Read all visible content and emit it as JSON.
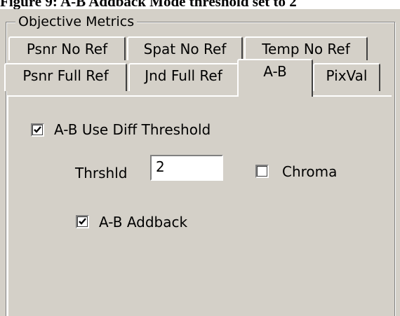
{
  "caption": "Figure 9: A-B Addback Mode threshold set to 2",
  "group": {
    "title": "Objective Metrics"
  },
  "tabs": {
    "row1": [
      {
        "label": "Psnr No Ref"
      },
      {
        "label": "Spat No Ref"
      },
      {
        "label": "Temp No Ref"
      }
    ],
    "row2": [
      {
        "label": "Psnr Full Ref"
      },
      {
        "label": "Jnd Full Ref"
      },
      {
        "label": "A-B",
        "active": true
      },
      {
        "label": "PixVal"
      }
    ]
  },
  "ab_page": {
    "use_diff_threshold": {
      "label": "A-B Use Diff Threshold",
      "checked": true
    },
    "threshold": {
      "label": "Thrshld",
      "value": "2"
    },
    "chroma": {
      "label": "Chroma",
      "checked": false
    },
    "addback": {
      "label": "A-B Addback",
      "checked": true
    }
  }
}
